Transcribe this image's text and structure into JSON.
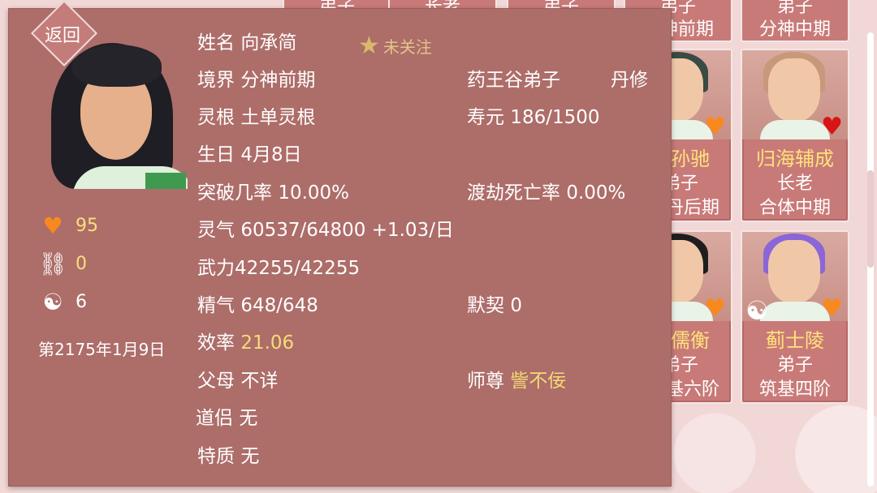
{
  "back_label": "返回",
  "follow": {
    "label": "未关注"
  },
  "character": {
    "name_label": "姓名",
    "name": "向承简",
    "realm_label": "境界",
    "realm": "分神前期",
    "sect": "药王谷弟子",
    "path": "丹修",
    "root_label": "灵根",
    "root": "土单灵根",
    "lifespan_label": "寿元",
    "lifespan": "186/1500",
    "birthday_label": "生日",
    "birthday": "4月8日",
    "breakthrough_label": "突破几率",
    "breakthrough": "10.00%",
    "tribulation_label": "渡劫死亡率",
    "tribulation": "0.00%",
    "qi_label": "灵气",
    "qi": "60537/64800 +1.03/日",
    "force_label": "武力",
    "force": "42255/42255",
    "essence_label": "精气",
    "essence": "648/648",
    "tacit_label": "默契",
    "tacit": "0",
    "efficiency_label": "效率",
    "efficiency": "21.06",
    "parents_label": "父母",
    "parents": "不详",
    "master_label": "师尊",
    "master": "訾不佞",
    "partner_label": "道侣",
    "partner": "无",
    "traits_label": "特质",
    "traits": "无"
  },
  "side_stats": {
    "favor": "95",
    "shackle": "0",
    "yinyang": "6",
    "date": "第2175年1月9日"
  },
  "colors": {
    "heart_orange": "#f7891f",
    "heart_red": "#d81414",
    "highlight": "#f4dc78"
  },
  "cards": {
    "top_row": [
      {
        "line1": "弟子"
      },
      {
        "line1": "长老"
      },
      {
        "line1": "弟子"
      },
      {
        "line1": "弟子",
        "line2": "分神前期"
      },
      {
        "line1": "弟子",
        "line2": "分神中期"
      }
    ],
    "mid_partial": {
      "name": "孙驰",
      "rank": "弟子",
      "level": "丹后期"
    },
    "mid_full": {
      "name": "归海辅成",
      "rank": "长老",
      "level": "合体中期"
    },
    "low_partial": {
      "name": "儒衡",
      "rank": "弟子",
      "level": "基六阶"
    },
    "low_full": {
      "name": "蓟士陵",
      "rank": "弟子",
      "level": "筑基四阶"
    }
  }
}
